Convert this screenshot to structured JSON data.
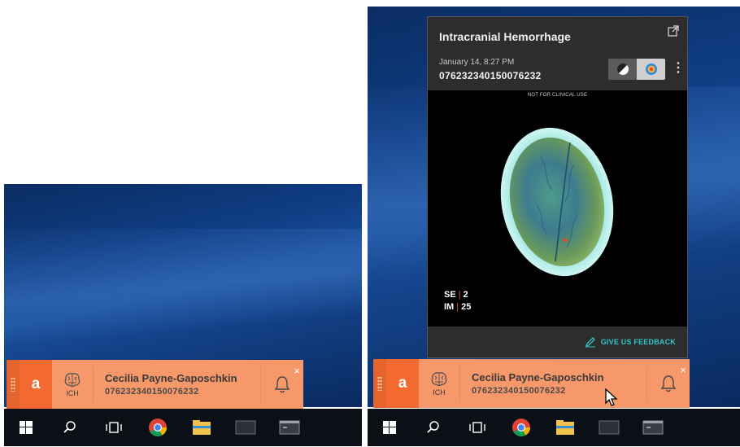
{
  "colors": {
    "brand_orange": "#f26a30",
    "notification_bg": "#f7986a",
    "feedback_teal": "#35c4c4",
    "panel_bg": "#2d2d2d",
    "taskbar_bg": "#0b0f16"
  },
  "notification": {
    "app_letter": "a",
    "finding_icon": "brain-icon",
    "finding_label": "ICH",
    "patient_name": "Cecilia Payne-Gaposchkin",
    "accession": "076232340150076232",
    "bell_icon": "bell-icon",
    "close_label": "×"
  },
  "panel": {
    "title": "Intracranial Hemorrhage",
    "date": "January 14, 8:27 PM",
    "accession": "076232340150076232",
    "kebab": "⋮",
    "disclaimer": "NOT FOR CLINICAL USE",
    "series_label": "SE",
    "series_value": "2",
    "image_label": "IM",
    "image_value": "25",
    "feedback_label": "GIVE US FEEDBACK"
  },
  "taskbar": {
    "icons": [
      "windows-start-icon",
      "search-icon",
      "task-view-icon",
      "chrome-icon",
      "file-explorer-icon",
      "app-window-icon",
      "terminal-icon"
    ]
  }
}
